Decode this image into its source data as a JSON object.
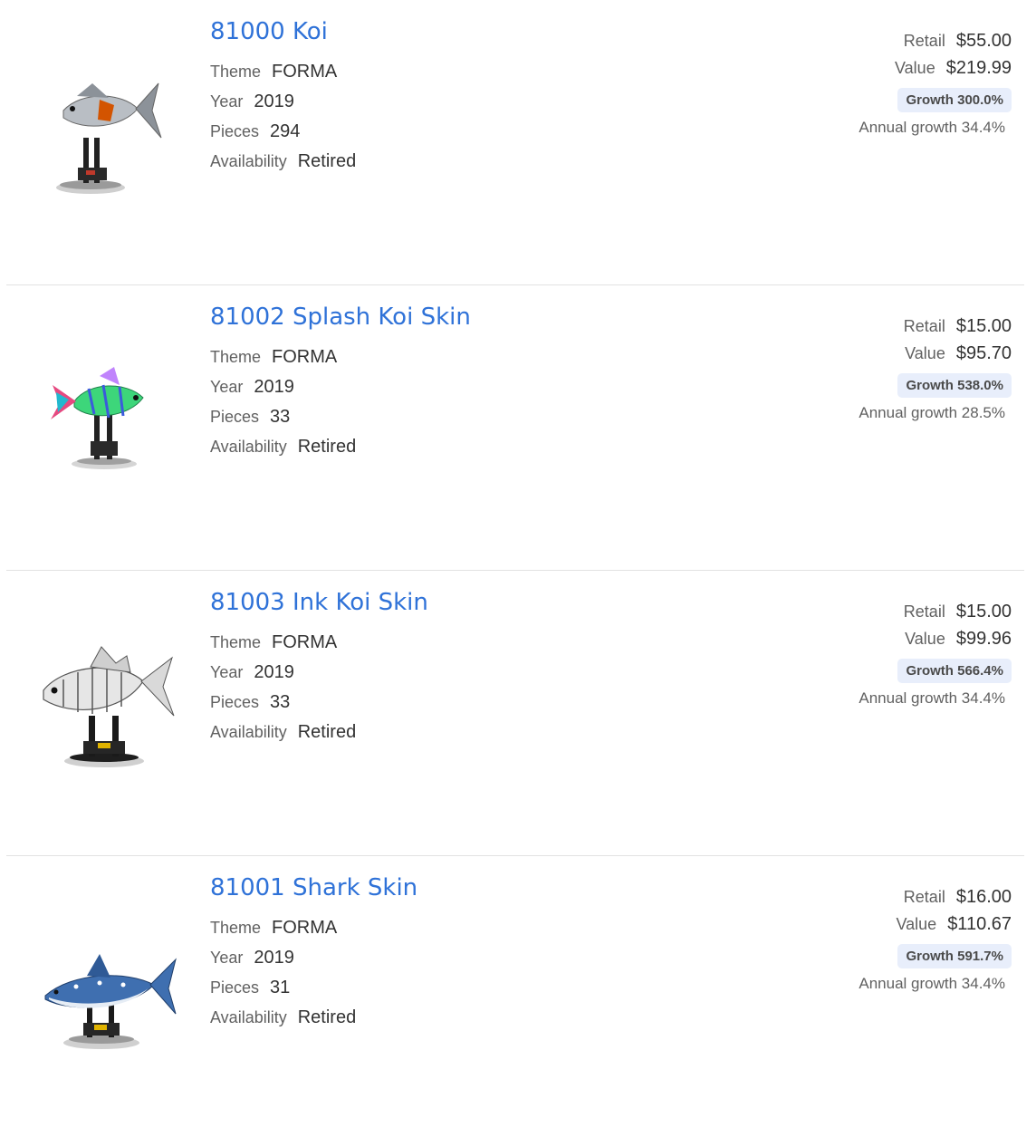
{
  "labels": {
    "theme": "Theme",
    "year": "Year",
    "pieces": "Pieces",
    "availability": "Availability",
    "retail": "Retail",
    "value": "Value",
    "growth_prefix": "Growth",
    "annual_prefix": "Annual growth"
  },
  "colors": {
    "link": "#2f72d8",
    "badge_bg": "#e8eefb",
    "divider": "#e2e2e2"
  },
  "sets": [
    {
      "title": "81000 Koi",
      "theme": "FORMA",
      "year": "2019",
      "pieces": "294",
      "availability": "Retired",
      "retail": "$55.00",
      "value": "$219.99",
      "growth": "Growth 300.0%",
      "annual": "Annual growth 34.4%",
      "image_icon": "koi-model-image"
    },
    {
      "title": "81002 Splash Koi Skin",
      "theme": "FORMA",
      "year": "2019",
      "pieces": "33",
      "availability": "Retired",
      "retail": "$15.00",
      "value": "$95.70",
      "growth": "Growth 538.0%",
      "annual": "Annual growth 28.5%",
      "image_icon": "splash-koi-model-image"
    },
    {
      "title": "81003 Ink Koi Skin",
      "theme": "FORMA",
      "year": "2019",
      "pieces": "33",
      "availability": "Retired",
      "retail": "$15.00",
      "value": "$99.96",
      "growth": "Growth 566.4%",
      "annual": "Annual growth 34.4%",
      "image_icon": "ink-koi-model-image"
    },
    {
      "title": "81001 Shark Skin",
      "theme": "FORMA",
      "year": "2019",
      "pieces": "31",
      "availability": "Retired",
      "retail": "$16.00",
      "value": "$110.67",
      "growth": "Growth 591.7%",
      "annual": "Annual growth 34.4%",
      "image_icon": "shark-model-image"
    }
  ]
}
